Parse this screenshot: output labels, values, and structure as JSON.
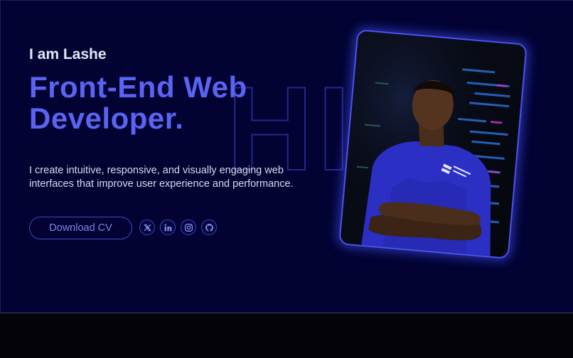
{
  "hero": {
    "intro": "I am Lashe",
    "title_line1": "Front-End Web",
    "title_line2": "Developer.",
    "watermark": "HI",
    "description": "I create intuitive, responsive, and visually engaging web interfaces that improve user experience and performance.",
    "download_label": "Download CV"
  },
  "socials": [
    {
      "name": "x-icon"
    },
    {
      "name": "linkedin-icon"
    },
    {
      "name": "instagram-icon"
    },
    {
      "name": "github-icon"
    }
  ],
  "colors": {
    "background": "#020333",
    "accent": "#5a63f2",
    "footer": "#030309"
  }
}
